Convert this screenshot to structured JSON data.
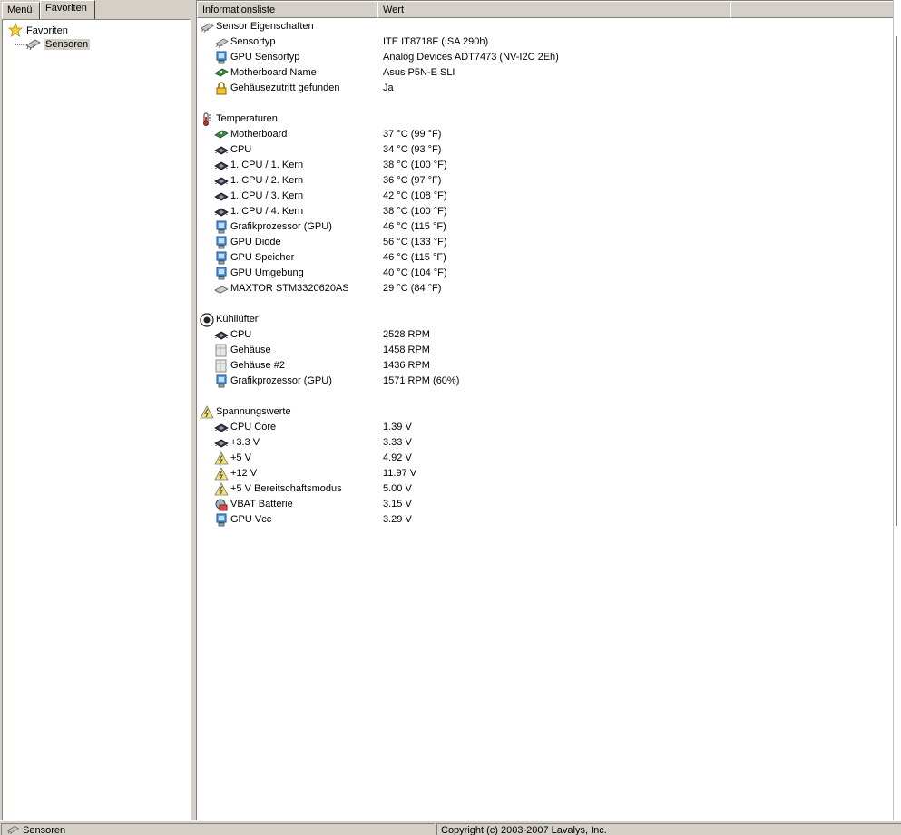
{
  "left_panel": {
    "tabs": [
      {
        "label": "Menü",
        "active": false
      },
      {
        "label": "Favoriten",
        "active": true
      }
    ],
    "tree": {
      "root": {
        "label": "Favoriten",
        "icon": "star-icon"
      },
      "child": {
        "label": "Sensoren",
        "icon": "sensor-chip-icon",
        "selected": true
      }
    }
  },
  "list": {
    "columns": [
      "Informationsliste",
      "Wert",
      ""
    ],
    "sections": [
      {
        "title": "Sensor Eigenschaften",
        "icon": "sensor-chip-icon",
        "items": [
          {
            "label": "Sensortyp",
            "value": "ITE IT8718F  (ISA 290h)",
            "icon": "sensor-chip-icon"
          },
          {
            "label": "GPU Sensortyp",
            "value": "Analog Devices ADT7473  (NV-I2C 2Eh)",
            "icon": "gpu-monitor-icon"
          },
          {
            "label": "Motherboard Name",
            "value": "Asus P5N-E SLI",
            "icon": "motherboard-icon"
          },
          {
            "label": "Gehäusezutritt gefunden",
            "value": "Ja",
            "icon": "lock-icon"
          }
        ]
      },
      {
        "title": "Temperaturen",
        "icon": "thermometer-icon",
        "items": [
          {
            "label": "Motherboard",
            "value": "37 °C  (99 °F)",
            "icon": "motherboard-icon"
          },
          {
            "label": "CPU",
            "value": "34 °C  (93 °F)",
            "icon": "cpu-chip-icon"
          },
          {
            "label": "1. CPU / 1. Kern",
            "value": "38 °C  (100 °F)",
            "icon": "cpu-chip-icon"
          },
          {
            "label": "1. CPU / 2. Kern",
            "value": "36 °C  (97 °F)",
            "icon": "cpu-chip-icon"
          },
          {
            "label": "1. CPU / 3. Kern",
            "value": "42 °C  (108 °F)",
            "icon": "cpu-chip-icon"
          },
          {
            "label": "1. CPU / 4. Kern",
            "value": "38 °C  (100 °F)",
            "icon": "cpu-chip-icon"
          },
          {
            "label": "Grafikprozessor (GPU)",
            "value": "46 °C  (115 °F)",
            "icon": "gpu-monitor-icon"
          },
          {
            "label": "GPU Diode",
            "value": "56 °C  (133 °F)",
            "icon": "gpu-monitor-icon"
          },
          {
            "label": "GPU Speicher",
            "value": "46 °C  (115 °F)",
            "icon": "gpu-monitor-icon"
          },
          {
            "label": "GPU Umgebung",
            "value": "40 °C  (104 °F)",
            "icon": "gpu-monitor-icon"
          },
          {
            "label": "MAXTOR STM3320620AS",
            "value": "29 °C  (84 °F)",
            "icon": "hard-drive-icon"
          }
        ]
      },
      {
        "title": "Kühllüfter",
        "icon": "fan-icon",
        "items": [
          {
            "label": "CPU",
            "value": "2528 RPM",
            "icon": "cpu-chip-icon"
          },
          {
            "label": "Gehäuse",
            "value": "1458 RPM",
            "icon": "case-icon"
          },
          {
            "label": "Gehäuse #2",
            "value": "1436 RPM",
            "icon": "case-icon"
          },
          {
            "label": "Grafikprozessor (GPU)",
            "value": "1571 RPM  (60%)",
            "icon": "gpu-monitor-icon"
          }
        ]
      },
      {
        "title": "Spannungswerte",
        "icon": "voltage-warning-icon",
        "items": [
          {
            "label": "CPU Core",
            "value": "1.39 V",
            "icon": "cpu-chip-icon"
          },
          {
            "label": "+3.3 V",
            "value": "3.33 V",
            "icon": "cpu-chip-icon"
          },
          {
            "label": "+5 V",
            "value": "4.92 V",
            "icon": "voltage-warning-icon"
          },
          {
            "label": "+12 V",
            "value": "11.97 V",
            "icon": "voltage-warning-icon"
          },
          {
            "label": "+5 V Bereitschaftsmodus",
            "value": "5.00 V",
            "icon": "voltage-warning-icon"
          },
          {
            "label": "VBAT Batterie",
            "value": "3.15 V",
            "icon": "battery-icon"
          },
          {
            "label": "GPU Vcc",
            "value": "3.29 V",
            "icon": "gpu-monitor-icon"
          }
        ]
      }
    ]
  },
  "statusbar": {
    "left": {
      "label": "Sensoren",
      "icon": "sensor-chip-icon"
    },
    "right": "Copyright (c) 2003-2007 Lavalys, Inc."
  }
}
